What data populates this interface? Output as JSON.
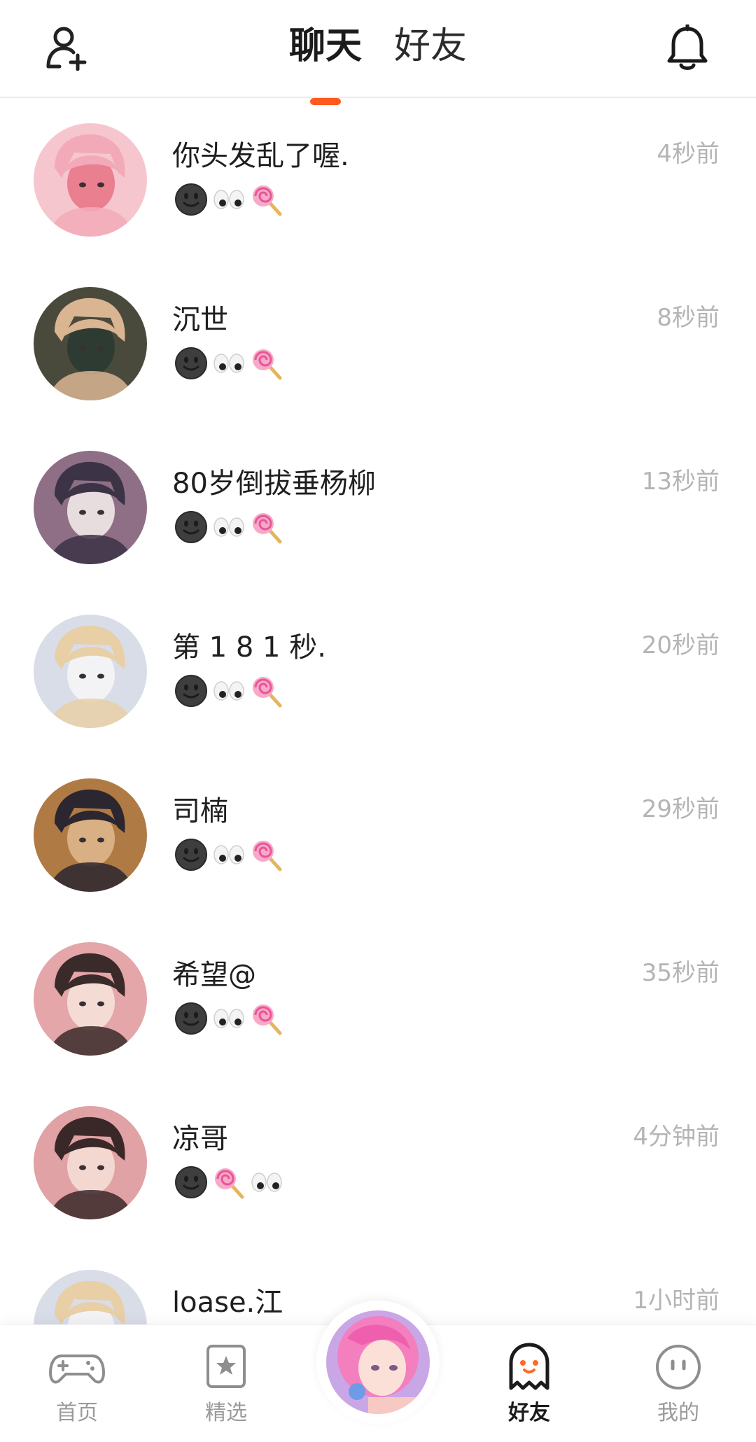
{
  "header": {
    "tabs": [
      {
        "label": "聊天",
        "active": true
      },
      {
        "label": "好友",
        "active": false
      }
    ],
    "left_icon": "add-friend-icon",
    "right_icon": "bell-icon",
    "accent_color": "#ff5a1f"
  },
  "chats": [
    {
      "name": "你头发乱了喔.",
      "time": "4秒前",
      "emojis": [
        "dark-face",
        "eyes",
        "lollipop"
      ],
      "avatar_palette": [
        "#f6c6cf",
        "#f3aab8",
        "#e97f8f"
      ]
    },
    {
      "name": "沉世",
      "time": "8秒前",
      "emojis": [
        "dark-face",
        "eyes",
        "lollipop"
      ],
      "avatar_palette": [
        "#4a4a3c",
        "#d9b592",
        "#2e3b33"
      ]
    },
    {
      "name": "80岁倒拔垂杨柳",
      "time": "13秒前",
      "emojis": [
        "dark-face",
        "eyes",
        "lollipop"
      ],
      "avatar_palette": [
        "#8e6f86",
        "#3c3346",
        "#e8ddde"
      ]
    },
    {
      "name": "第 1 8 1 秒.",
      "time": "20秒前",
      "emojis": [
        "dark-face",
        "eyes",
        "lollipop"
      ],
      "avatar_palette": [
        "#d9dde8",
        "#e8cfa6",
        "#f3f3f6"
      ]
    },
    {
      "name": "司楠",
      "time": "29秒前",
      "emojis": [
        "dark-face",
        "eyes",
        "lollipop"
      ],
      "avatar_palette": [
        "#b07a44",
        "#2b2630",
        "#d9b083"
      ]
    },
    {
      "name": "希望@",
      "time": "35秒前",
      "emojis": [
        "dark-face",
        "eyes",
        "lollipop"
      ],
      "avatar_palette": [
        "#e4a6a8",
        "#3b2a2a",
        "#f4dcd4"
      ]
    },
    {
      "name": "凉哥",
      "time": "4分钟前",
      "emojis": [
        "dark-face",
        "lollipop",
        "eyes"
      ],
      "avatar_palette": [
        "#e0a2a4",
        "#3a2829",
        "#f2d8d0"
      ]
    },
    {
      "name": "loase.江",
      "time": "1小时前",
      "emojis": [],
      "avatar_palette": [
        "#d9dde8",
        "#e8cfa6",
        "#f3f3f6"
      ]
    }
  ],
  "bottom_nav": [
    {
      "label": "首页",
      "icon": "gamepad-icon",
      "active": false
    },
    {
      "label": "精选",
      "icon": "star-bookmark-icon",
      "active": false
    },
    {
      "label": "好友",
      "icon": "ghost-icon",
      "active": true
    },
    {
      "label": "我的",
      "icon": "smiley-icon",
      "active": false
    }
  ]
}
